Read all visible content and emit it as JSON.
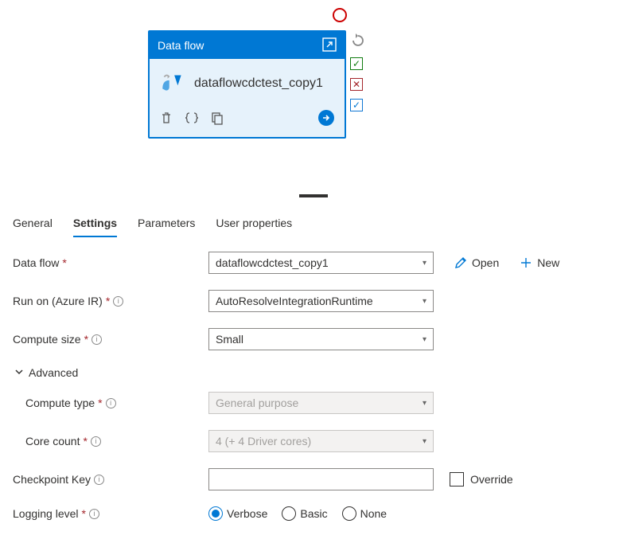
{
  "card": {
    "title": "Data flow",
    "name": "dataflowcdctest_copy1"
  },
  "tabs": {
    "general": "General",
    "settings": "Settings",
    "parameters": "Parameters",
    "user_properties": "User properties"
  },
  "labels": {
    "data_flow": "Data flow",
    "run_on": "Run on (Azure IR)",
    "compute_size": "Compute size",
    "advanced": "Advanced",
    "compute_type": "Compute type",
    "core_count": "Core count",
    "checkpoint_key": "Checkpoint Key",
    "logging_level": "Logging level",
    "override": "Override",
    "open": "Open",
    "new": "New"
  },
  "values": {
    "data_flow": "dataflowcdctest_copy1",
    "run_on": "AutoResolveIntegrationRuntime",
    "compute_size": "Small",
    "compute_type": "General purpose",
    "core_count": "4 (+ 4 Driver cores)",
    "checkpoint_key": ""
  },
  "radio": {
    "verbose": "Verbose",
    "basic": "Basic",
    "none": "None"
  }
}
